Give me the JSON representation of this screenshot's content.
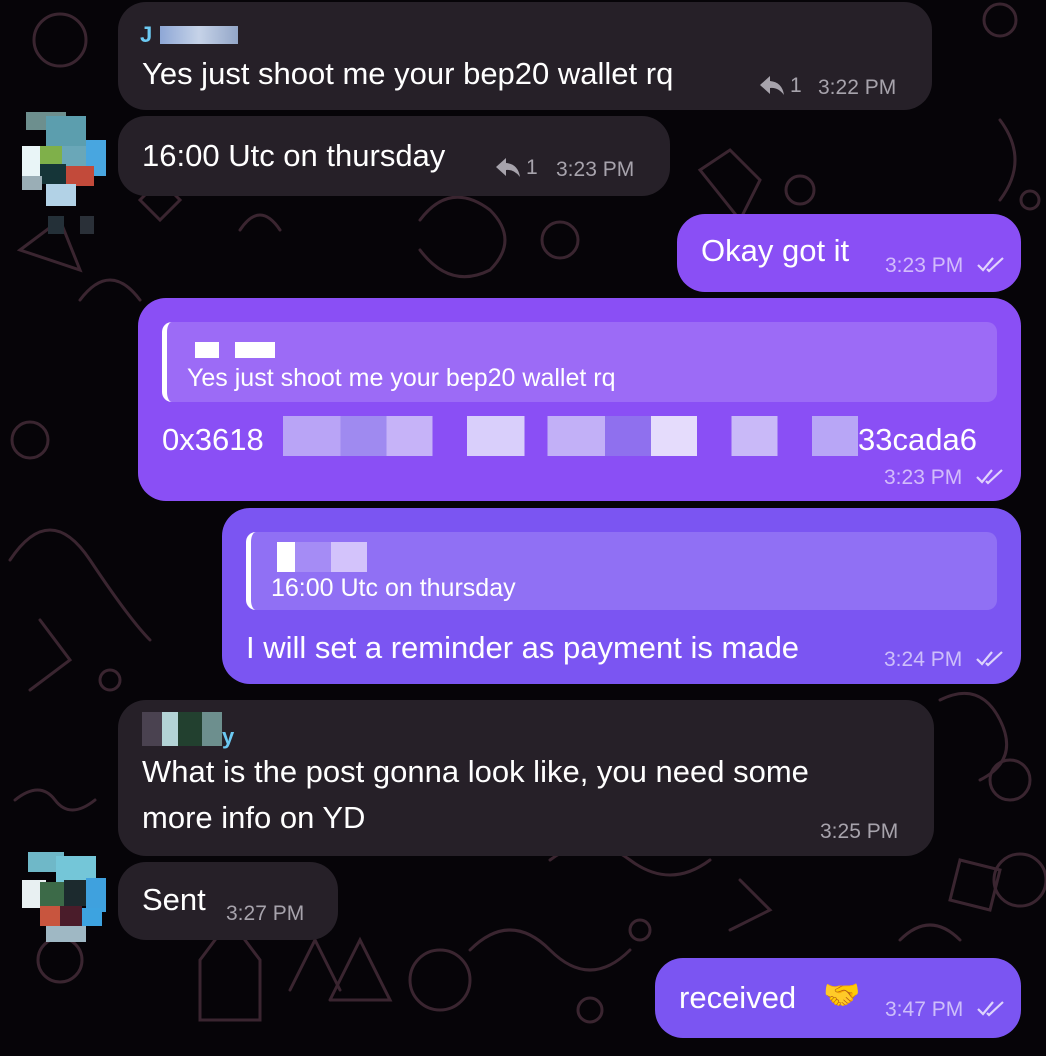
{
  "messages": [
    {
      "id": "m1",
      "direction": "incoming",
      "sender": "J",
      "text": "Yes just shoot me your bep20 wallet rq",
      "reply_count": "1",
      "time": "3:22 PM"
    },
    {
      "id": "m2",
      "direction": "incoming",
      "text": "16:00 Utc on thursday",
      "reply_count": "1",
      "time": "3:23 PM"
    },
    {
      "id": "m3",
      "direction": "outgoing",
      "text": "Okay got it",
      "time": "3:23 PM",
      "read": true
    },
    {
      "id": "m4",
      "direction": "outgoing",
      "quote_text": "Yes just shoot me your bep20 wallet rq",
      "text_start": "0x3618",
      "text_end": "33cada6",
      "time": "3:23 PM",
      "read": true
    },
    {
      "id": "m5",
      "direction": "outgoing",
      "quote_text": "16:00 Utc on thursday",
      "text": "I will set a reminder as payment is made",
      "time": "3:24 PM",
      "read": true
    },
    {
      "id": "m6",
      "direction": "incoming",
      "sender": "y",
      "text_line1": "What is the post gonna look like, you need some",
      "text_line2": "more info on YD",
      "time": "3:25 PM"
    },
    {
      "id": "m7",
      "direction": "incoming",
      "text": "Sent",
      "time": "3:27 PM"
    },
    {
      "id": "m8",
      "direction": "outgoing",
      "text": "received",
      "emoji": "🤝",
      "time": "3:47 PM",
      "read": true
    }
  ],
  "icons": {
    "reply": "reply-arrow-icon",
    "read": "double-check-icon",
    "emoji": "handshake-emoji"
  },
  "colors": {
    "background": "#060408",
    "incoming_bubble": "#262028",
    "outgoing_bubble": "#8a4ff5",
    "outgoing_bubble_alt": "#7b55f2",
    "sender_name": "#6cc9f2"
  }
}
